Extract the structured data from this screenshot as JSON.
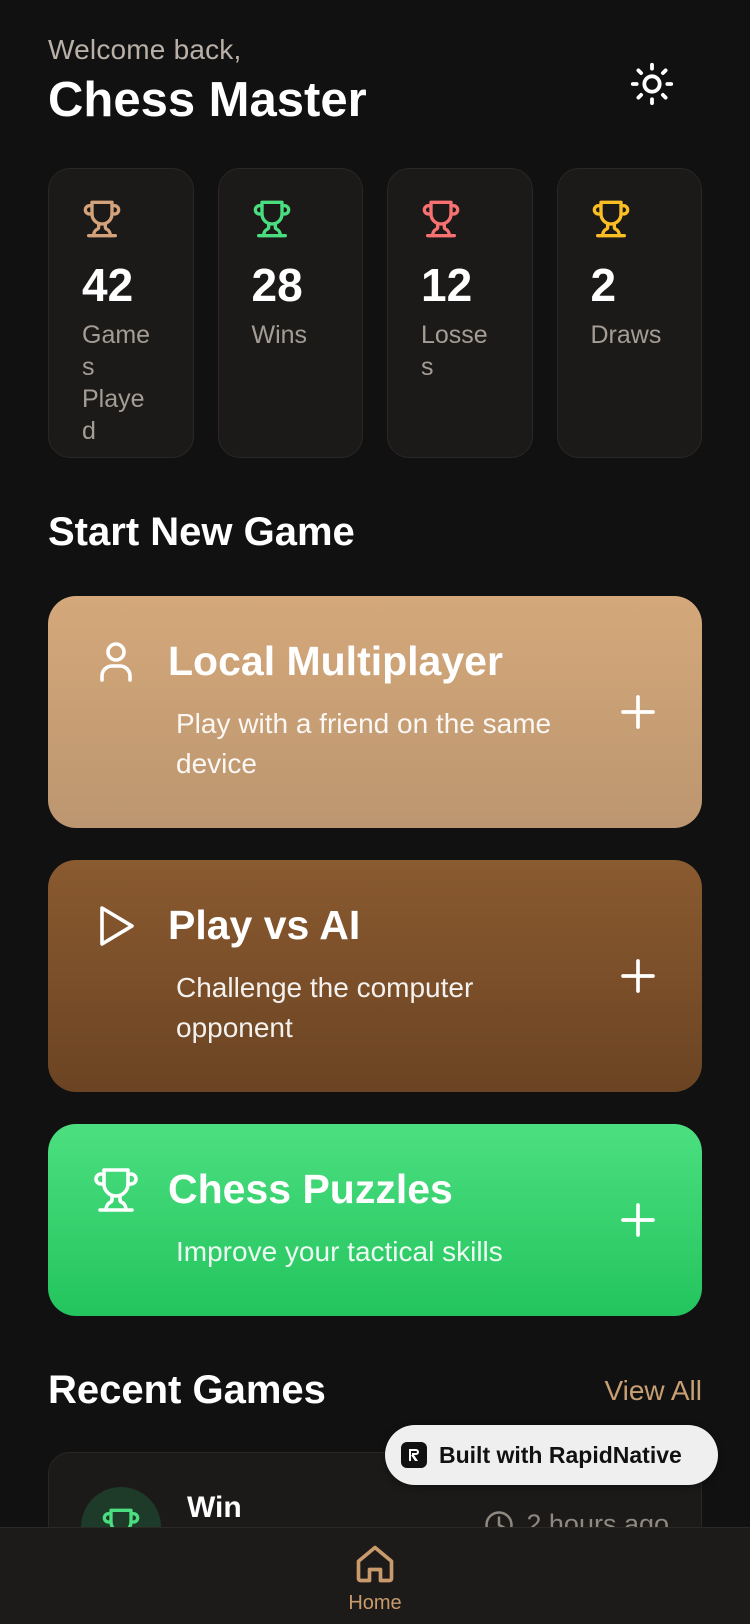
{
  "header": {
    "welcome": "Welcome back,",
    "username": "Chess Master",
    "theme_icon": "sun-icon"
  },
  "stats": [
    {
      "value": "42",
      "label": "Games Played",
      "color": "#d4a27a",
      "icon": "trophy-icon"
    },
    {
      "value": "28",
      "label": "Wins",
      "color": "#4ade80",
      "icon": "trophy-icon"
    },
    {
      "value": "12",
      "label": "Losses",
      "color": "#f87171",
      "icon": "trophy-icon"
    },
    {
      "value": "2",
      "label": "Draws",
      "color": "#fbbf24",
      "icon": "trophy-icon"
    }
  ],
  "new_game": {
    "title": "Start New Game",
    "modes": [
      {
        "title": "Local Multiplayer",
        "description": "Play with a friend on the same device",
        "icon": "user-icon"
      },
      {
        "title": "Play vs AI",
        "description": "Challenge the computer opponent",
        "icon": "play-icon"
      },
      {
        "title": "Chess Puzzles",
        "description": "Improve your tactical skills",
        "icon": "trophy-icon"
      }
    ]
  },
  "recent": {
    "title": "Recent Games",
    "view_all": "View All",
    "games": [
      {
        "result": "Win",
        "time": "2 hours ago"
      }
    ]
  },
  "badge": {
    "text": "Built with RapidNative"
  },
  "nav": {
    "home_label": "Home"
  },
  "colors": {
    "background": "#121111",
    "card": "#1c1a19",
    "accent": "#c99a6b",
    "win": "#4ade80"
  }
}
